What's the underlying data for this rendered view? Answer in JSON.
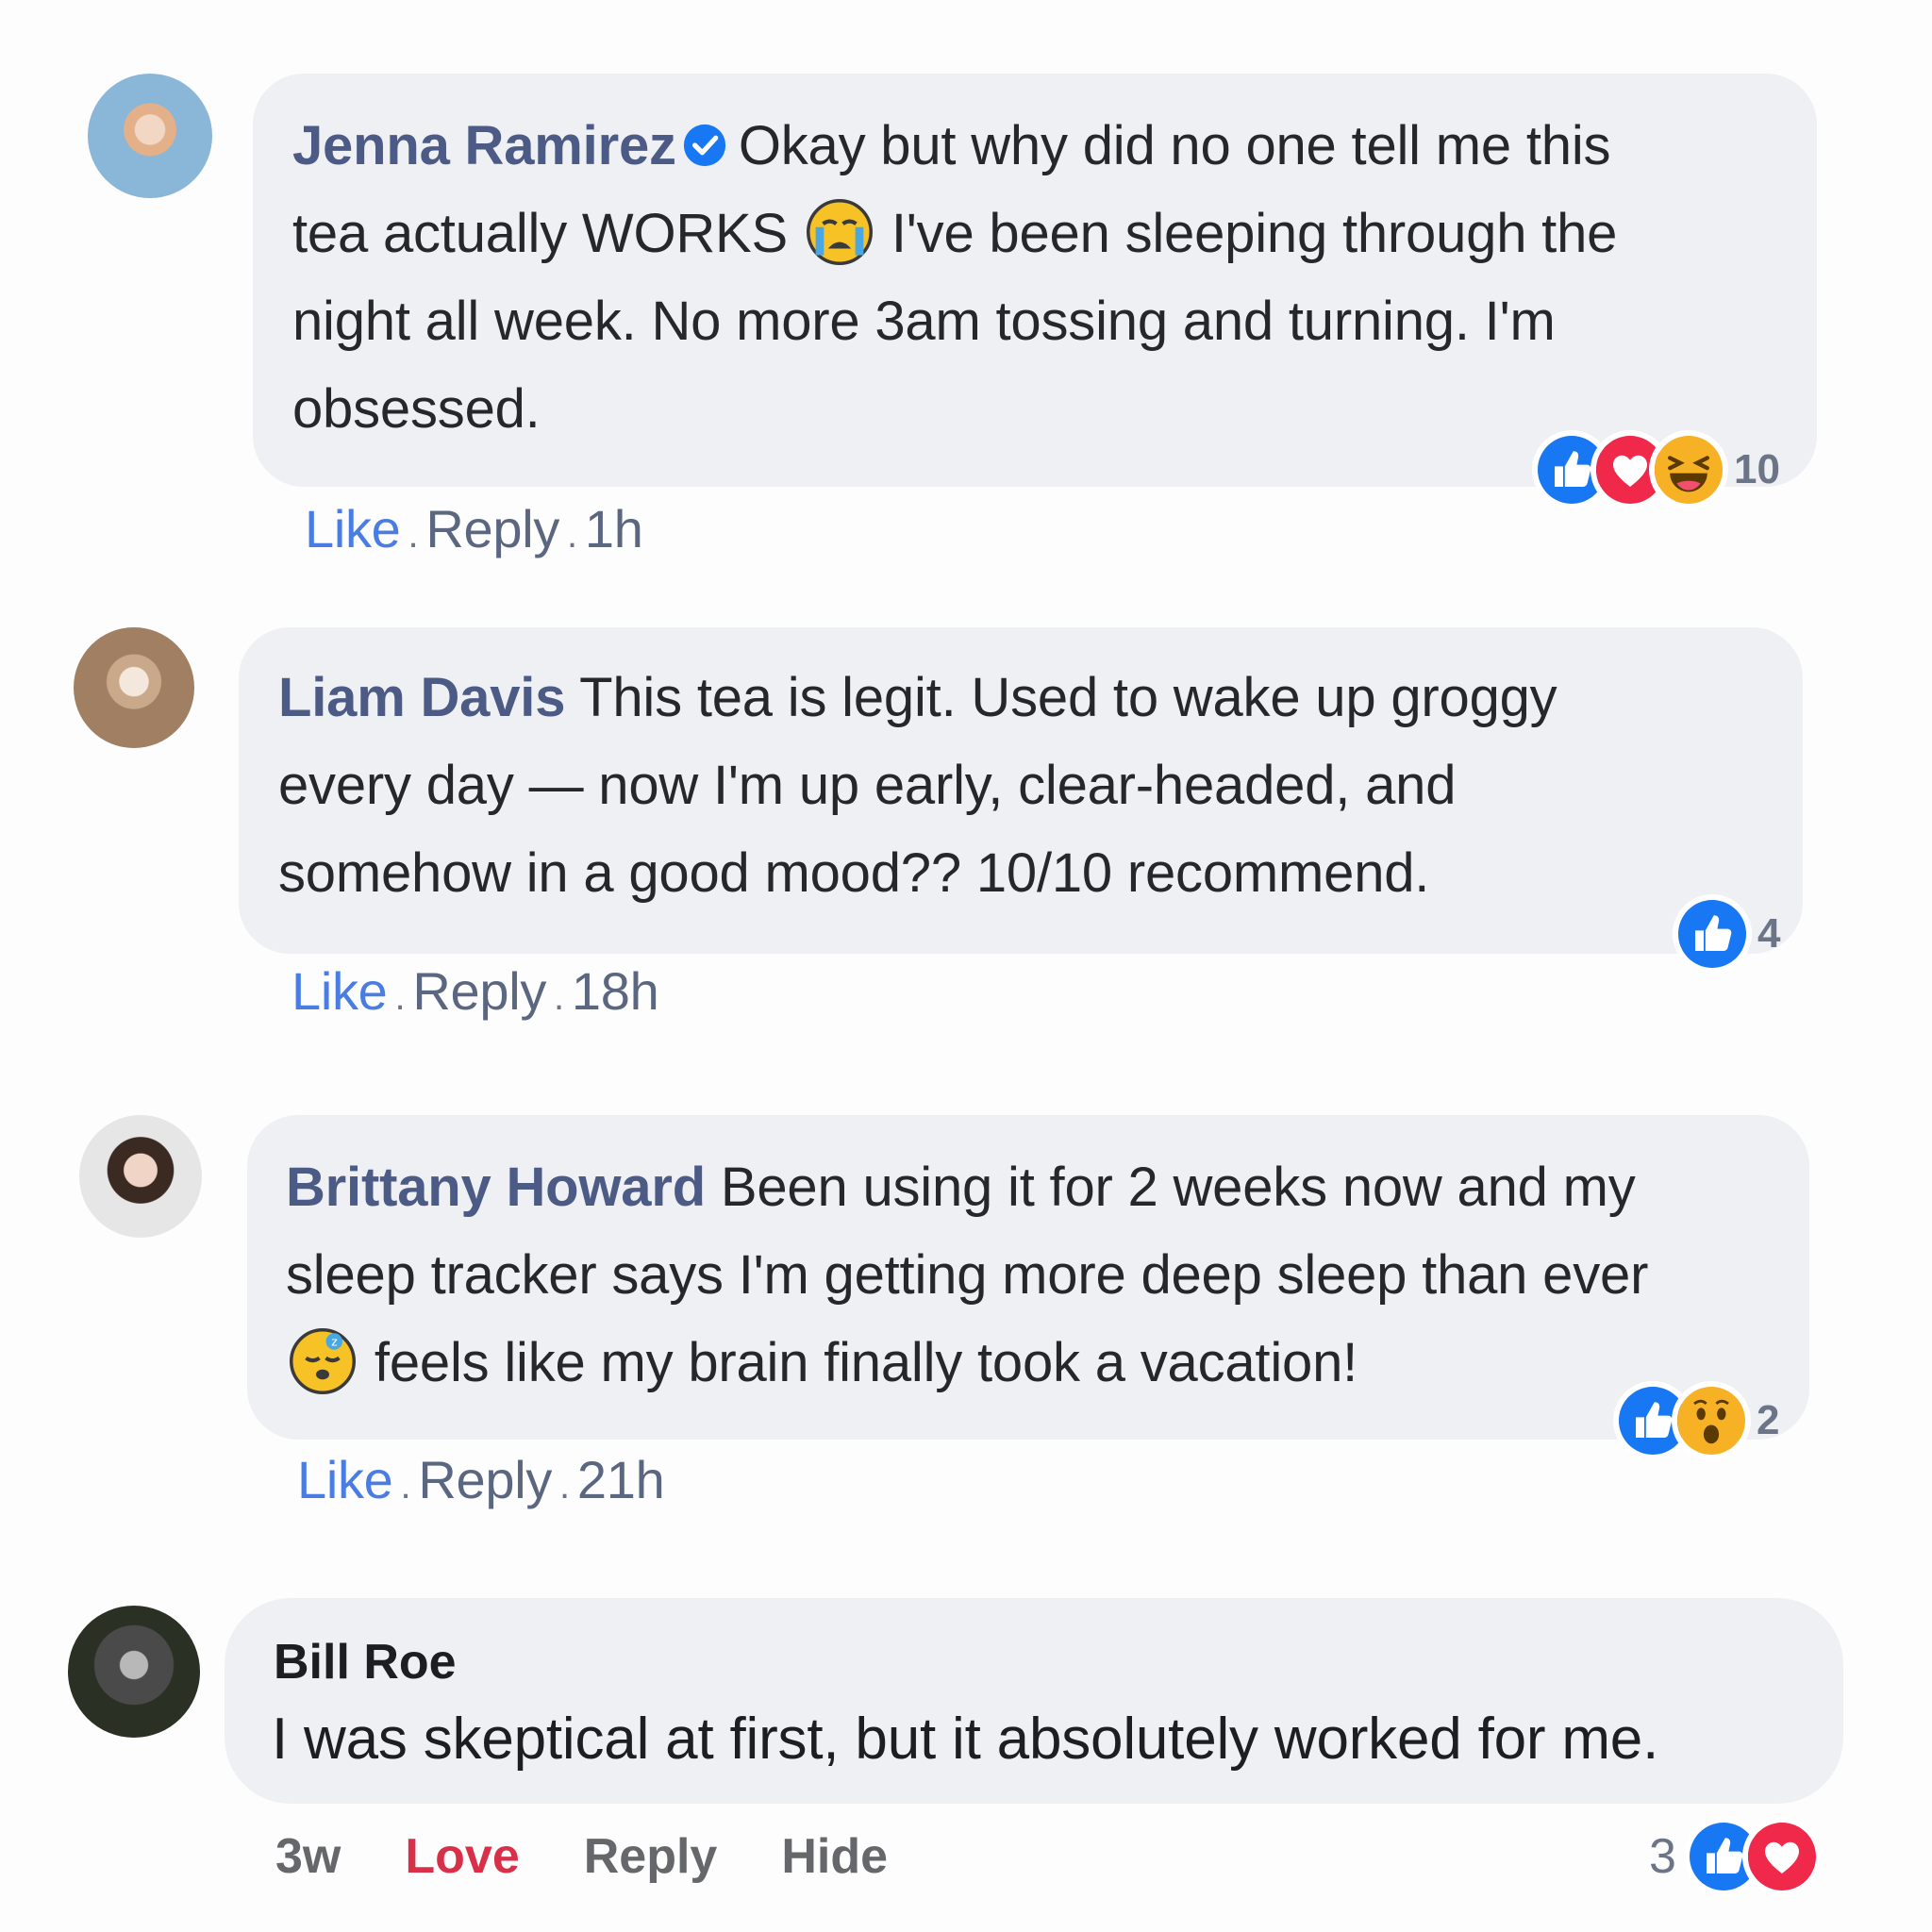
{
  "colors": {
    "like_blue": "#1877f2",
    "love_red": "#f02849",
    "bubble_bg": "#eef0f3",
    "author_color": "#4c5a86"
  },
  "comments": [
    {
      "author": "Jenna Ramirez",
      "verified": true,
      "text_lines": [
        "Okay but why did no one tell me this",
        "tea actually WORKS",
        "I've been sleeping through the",
        "night all week. No more 3am tossing and turning. I'm",
        "obsessed."
      ],
      "inline_emoji": "crying-face-icon",
      "actions": {
        "like": "Like",
        "reply": "Reply",
        "time": "1h",
        "separator": "."
      },
      "reactions": [
        "like-icon",
        "love-icon",
        "laughing-icon"
      ],
      "reaction_count": "10"
    },
    {
      "author": "Liam Davis",
      "verified": false,
      "text_lines": [
        "This tea is legit. Used to wake up groggy",
        "every day — now I'm up early, clear-headed, and",
        "somehow in a good mood?? 10/10 recommend."
      ],
      "actions": {
        "like": "Like",
        "reply": "Reply",
        "time": "18h",
        "separator": "."
      },
      "reactions": [
        "like-icon"
      ],
      "reaction_count": "4"
    },
    {
      "author": "Brittany Howard",
      "verified": false,
      "text_lines": [
        "Been using it for 2 weeks now and my",
        "sleep tracker says I'm getting more deep sleep than ever",
        "feels like my brain finally took a vacation!"
      ],
      "inline_emoji": "sleeping-face-icon",
      "actions": {
        "like": "Like",
        "reply": "Reply",
        "time": "21h",
        "separator": "."
      },
      "reactions": [
        "like-icon",
        "wow-icon"
      ],
      "reaction_count": "2"
    },
    {
      "author": "Bill Roe",
      "text": "I was skeptical at first, but it absolutely worked for me.",
      "actions": {
        "time": "3w",
        "love": "Love",
        "reply": "Reply",
        "hide": "Hide"
      },
      "reactions": [
        "like-icon",
        "love-icon"
      ],
      "reaction_count": "3"
    }
  ]
}
